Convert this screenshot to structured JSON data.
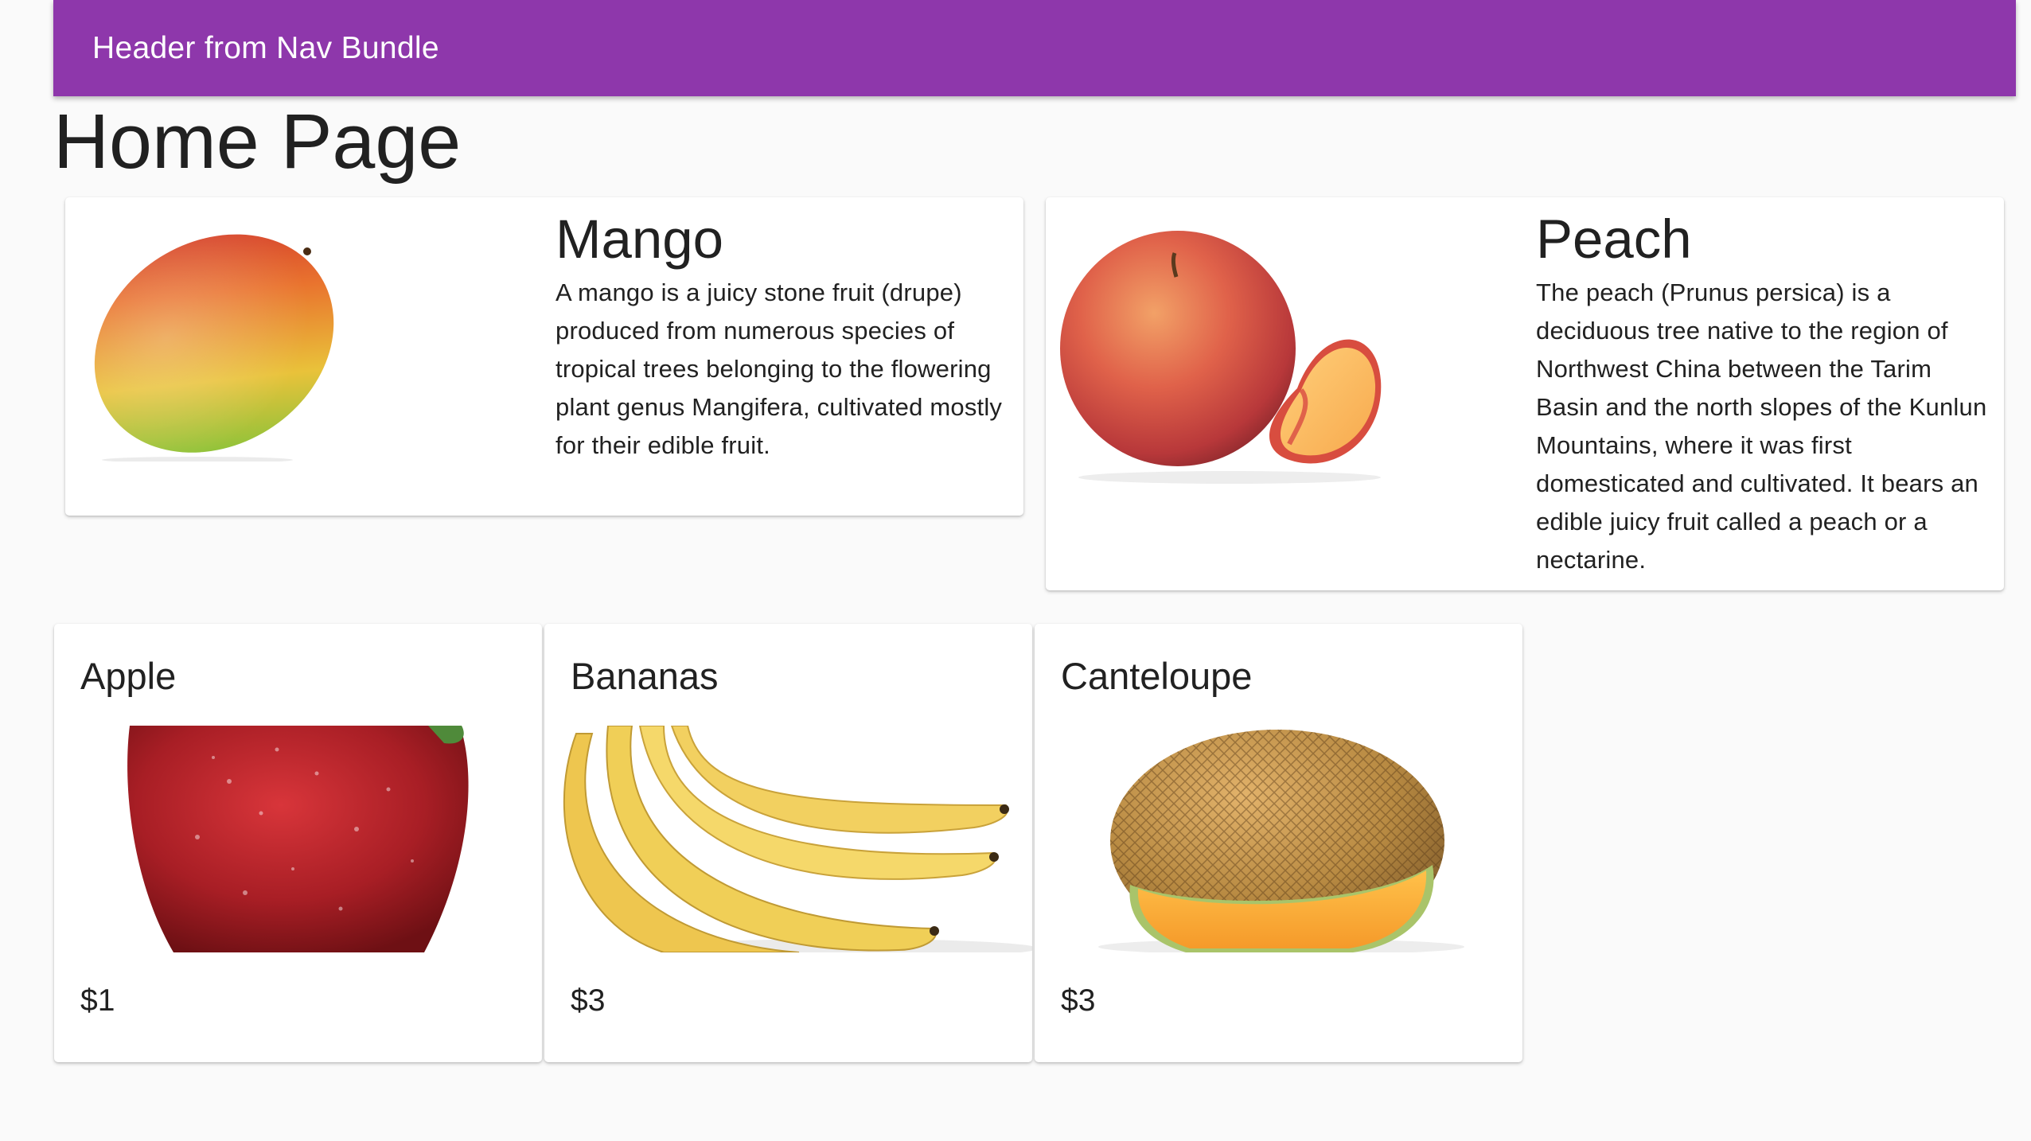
{
  "header": {
    "title": "Header from Nav Bundle",
    "color": "#8e37ab"
  },
  "page": {
    "title": "Home Page"
  },
  "featured": [
    {
      "name": "Mango",
      "description": "A mango is a juicy stone fruit (drupe) produced from numerous species of tropical trees belonging to the flowering plant genus Mangifera, cultivated mostly for their edible fruit.",
      "image": "mango-photo"
    },
    {
      "name": "Peach",
      "description": "The peach (Prunus persica) is a deciduous tree native to the region of Northwest China between the Tarim Basin and the north slopes of the Kunlun Mountains, where it was first domesticated and cultivated. It bears an edible juicy fruit called a peach or a nectarine.",
      "image": "peach-photo"
    }
  ],
  "products": [
    {
      "name": "Apple",
      "price": "$1",
      "image": "apple-photo"
    },
    {
      "name": "Bananas",
      "price": "$3",
      "image": "bananas-photo"
    },
    {
      "name": "Canteloupe",
      "price": "$3",
      "image": "cantaloupe-photo"
    }
  ]
}
